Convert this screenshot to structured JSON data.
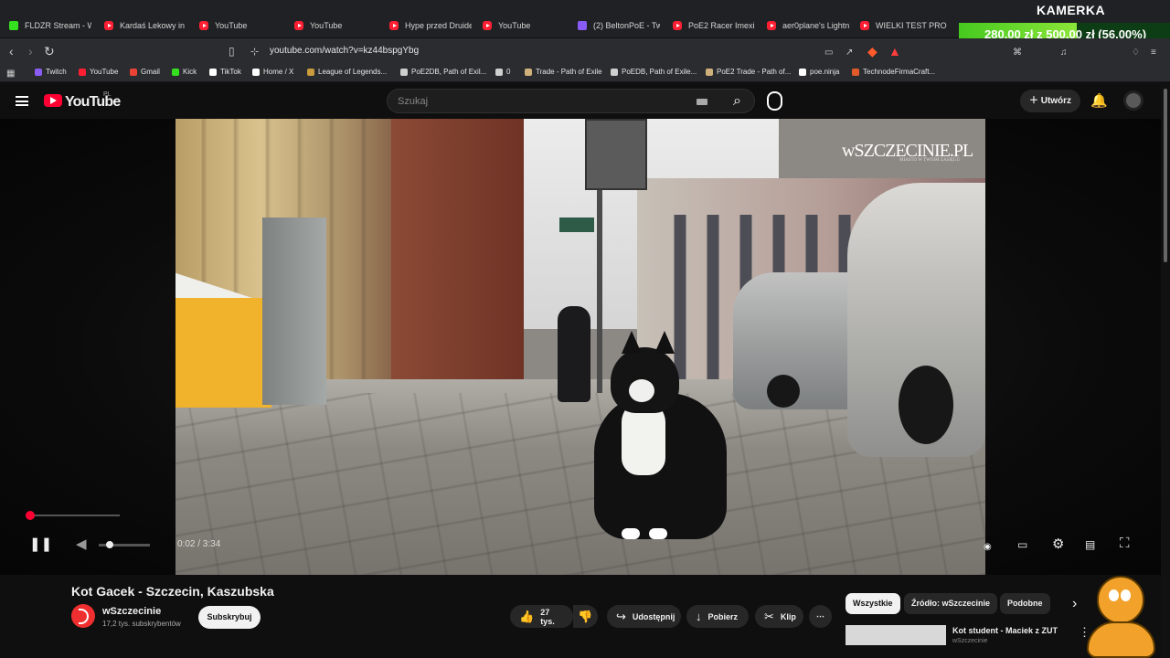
{
  "browser": {
    "tabs": [
      {
        "label": "FLDZR Stream - Wa",
        "type": "kick"
      },
      {
        "label": "Kardaś Lekowy in h",
        "type": "youtube"
      },
      {
        "label": "YouTube",
        "type": "youtube"
      },
      {
        "label": "YouTube",
        "type": "youtube"
      },
      {
        "label": "Hype przed Druider",
        "type": "youtube"
      },
      {
        "label": "YouTube",
        "type": "youtube"
      },
      {
        "label": "(2) BeltonPoE - Twi",
        "type": "twitch"
      },
      {
        "label": "PoE2 Racer Imexile",
        "type": "youtube"
      },
      {
        "label": "aer0plane's Lightnir",
        "type": "youtube"
      },
      {
        "label": "WIELKI TEST PRODU",
        "type": "youtube"
      }
    ],
    "url": "youtube.com/watch?v=kz44bspgYbg",
    "bookmarks": [
      {
        "label": "Twitch",
        "color": "#8a5cf6"
      },
      {
        "label": "YouTube",
        "color": "#ff1f33"
      },
      {
        "label": "Gmail",
        "color": "#ea4335"
      },
      {
        "label": "Kick",
        "color": "#35e01e"
      },
      {
        "label": "TikTok",
        "color": "#ffffff"
      },
      {
        "label": "Home / X",
        "color": "#ffffff"
      },
      {
        "label": "League of Legends...",
        "color": "#c89b3c"
      },
      {
        "label": "PoE2DB, Path of Exil...",
        "color": "#cfcfcf"
      },
      {
        "label": "0",
        "color": "#cfcfcf"
      },
      {
        "label": "Trade - Path of Exile",
        "color": "#d0b07a"
      },
      {
        "label": "PoEDB, Path of Exile...",
        "color": "#cfcfcf"
      },
      {
        "label": "PoE2 Trade - Path of...",
        "color": "#d0b07a"
      },
      {
        "label": "poe.ninja",
        "color": "#ffffff"
      },
      {
        "label": "TechnodeFirmaCraft...",
        "color": "#e05a2a"
      }
    ]
  },
  "overlay": {
    "kamerka_label": "KAMERKA",
    "donation_text": "280,00 zł z 500,00 zł (56.00%)",
    "donation_progress": 0.56
  },
  "youtube": {
    "logo_text": "YouTube",
    "region": "PL",
    "search_placeholder": "Szukaj",
    "create_label": "Utwórz",
    "video": {
      "watermark": "wSZCZECINIE.PL",
      "watermark_tagline": "MIASTO W TWOIM ZASIĘGU",
      "time": "0:02 / 3:34",
      "progress": 0.07,
      "title": "Kot Gacek - Szczecin, Kaszubska",
      "channel_name": "wSzczecinie",
      "subscribers": "17,2 tys. subskrybentów",
      "subscribe_label": "Subskrybuj",
      "likes": "27 tys.",
      "share_label": "Udostępnij",
      "download_label": "Pobierz",
      "clip_label": "Klip"
    },
    "chips": [
      "Wszystkie",
      "Źródło: wSzczecinie",
      "Podobne"
    ],
    "related": {
      "title": "Kot student - Maciek z ZUT",
      "channel": "wSzczecinie"
    }
  },
  "icons": {
    "back": "arrow-left-icon",
    "forward": "arrow-right-icon",
    "reload": "reload-icon",
    "bookmark": "bookmark-icon",
    "search": "search-icon",
    "mic": "microphone-icon",
    "bell": "bell-icon",
    "pause": "pause-icon",
    "volume": "volume-icon",
    "like": "thumb-up-icon",
    "dislike": "thumb-down-icon",
    "share": "share-icon",
    "download": "download-icon",
    "clip": "scissors-icon"
  }
}
